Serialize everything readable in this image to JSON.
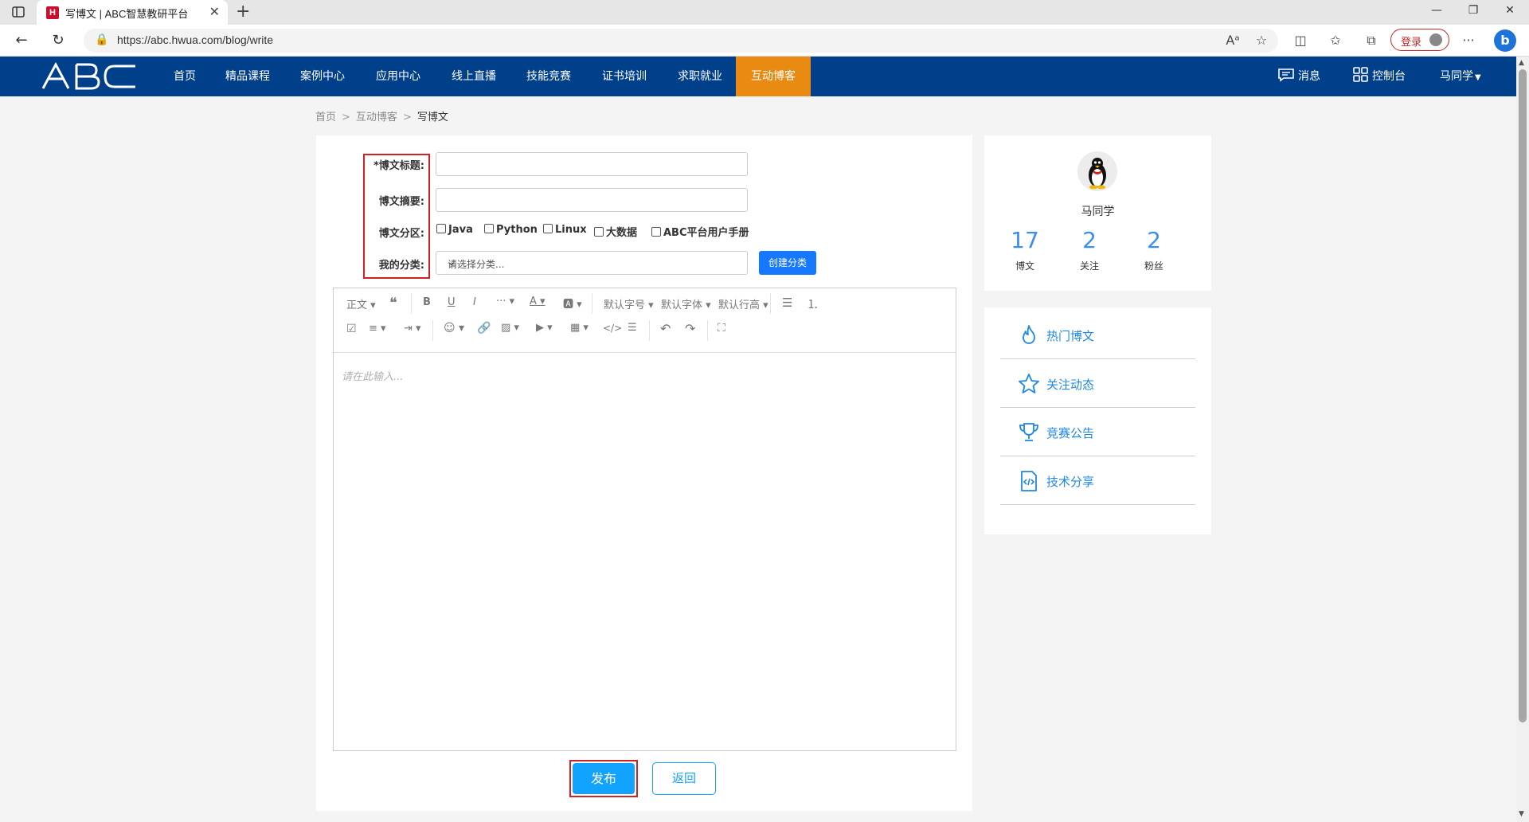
{
  "browser": {
    "tab_title": "写博文 | ABC智慧教研平台",
    "url": "https://abc.hwua.com/blog/write",
    "login_label": "登录"
  },
  "site": {
    "logo_text": "ABC",
    "nav": [
      "首页",
      "精品课程",
      "案例中心",
      "应用中心",
      "线上直播",
      "技能竞赛",
      "证书培训",
      "求职就业",
      "互动博客"
    ],
    "active_nav": "互动博客",
    "messages_label": "消息",
    "console_label": "控制台",
    "user_menu_label": "马同学"
  },
  "breadcrumb": {
    "home": "首页",
    "section": "互动博客",
    "current": "写博文"
  },
  "form": {
    "title_label": "*博文标题:",
    "summary_label": "博文摘要:",
    "category_label": "博文分区:",
    "my_category_label": "我的分类:",
    "title_value": "",
    "summary_value": "",
    "categories": [
      "Java",
      "Python",
      "Linux",
      "大数据",
      "ABC平台用户手册"
    ],
    "select_placeholder": "请选择分类...",
    "create_category_label": "创建分类"
  },
  "editor": {
    "toolbar": {
      "paragraph": "正文",
      "font_size": "默认字号",
      "font_family": "默认字体",
      "line_height": "默认行高"
    },
    "placeholder": "请在此输入..."
  },
  "actions": {
    "publish": "发布",
    "back": "返回"
  },
  "profile": {
    "name": "马同学",
    "stats": [
      {
        "value": "17",
        "label": "博文"
      },
      {
        "value": "2",
        "label": "关注"
      },
      {
        "value": "2",
        "label": "粉丝"
      }
    ]
  },
  "side_menu": [
    {
      "label": "热门博文",
      "icon": "flame-icon"
    },
    {
      "label": "关注动态",
      "icon": "star-icon"
    },
    {
      "label": "竞赛公告",
      "icon": "trophy-icon"
    },
    {
      "label": "技术分享",
      "icon": "code-file-icon"
    }
  ],
  "colors": {
    "nav_bg": "#003f8a",
    "nav_active": "#e98b12",
    "accent": "#11a3ff",
    "stat": "#3c8ef3",
    "highlight": "#d32020"
  }
}
